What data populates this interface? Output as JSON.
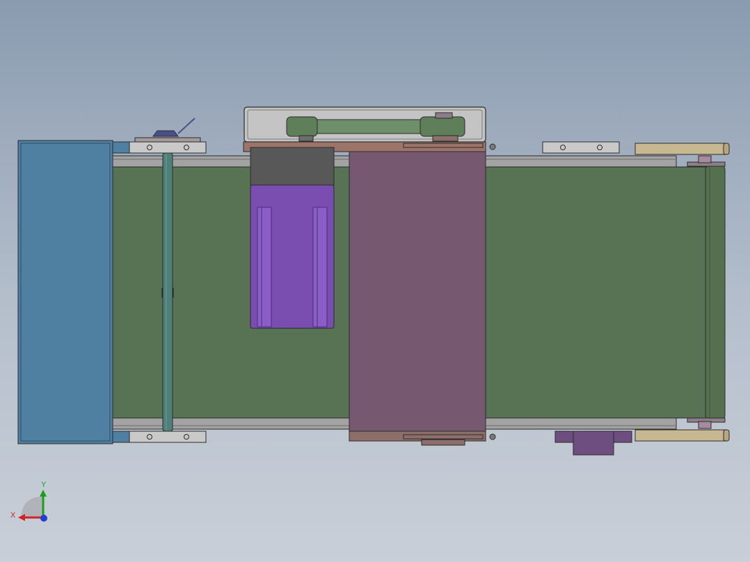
{
  "viewport": {
    "background_top": "#8a9bb0",
    "background_bottom": "#c9cfd8"
  },
  "colors": {
    "belt": "#577354",
    "side_panel": "#4f7fa1",
    "purple_block": "#765871",
    "motor": "#7a4db0",
    "motor_cap": "#585858",
    "frame_rail": "#9b9b9b",
    "roller_pin": "#4f8079",
    "tan_bracket": "#c8b891",
    "outline": "#2b2b2b"
  },
  "triad": {
    "x_label": "X",
    "y_label": "Y",
    "x_color": "#d42020",
    "y_color": "#18a018",
    "z_color": "#2040d0"
  }
}
